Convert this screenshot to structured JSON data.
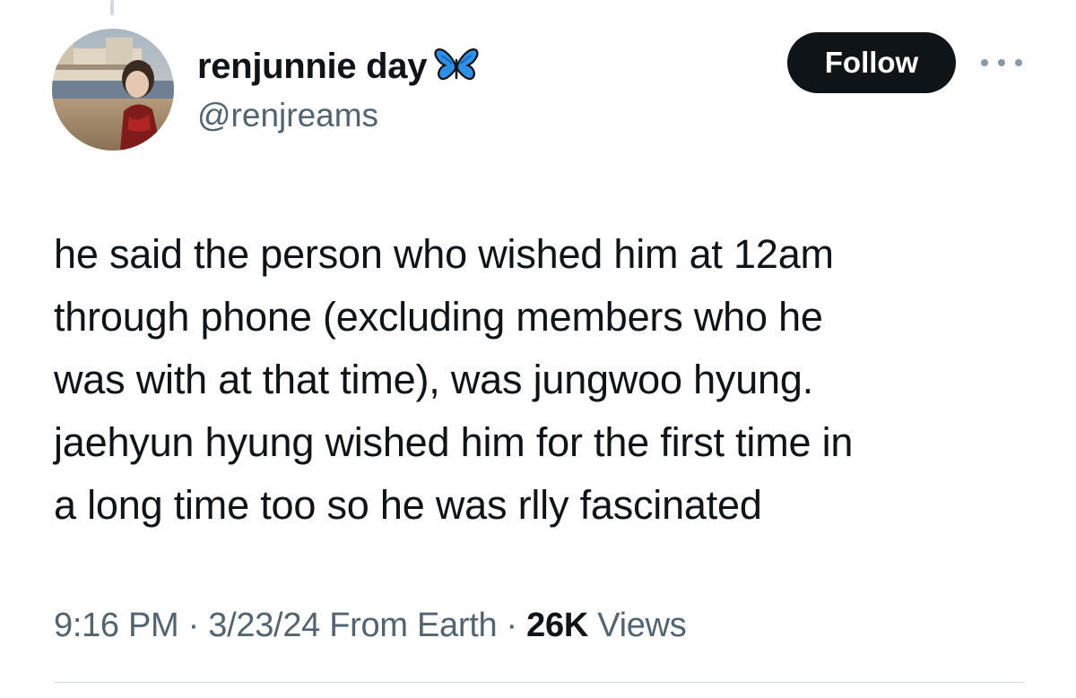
{
  "author": {
    "display_name": "renjunnie day",
    "badge_icon": "butterfly-icon",
    "handle": "@renjreams"
  },
  "actions": {
    "follow_label": "Follow",
    "more_icon": "more-horizontal-icon"
  },
  "tweet": {
    "lines": [
      "he said the person who wished him at 12am",
      "through phone (excluding members who he",
      "was with at that time), was jungwoo hyung.",
      "jaehyun hyung wished him for the first time in",
      "a long time too so he was rlly fascinated"
    ]
  },
  "meta": {
    "time": "9:16 PM",
    "separator": " · ",
    "date": "3/23/24",
    "source": "From Earth",
    "views_count": "26K",
    "views_label": "Views"
  },
  "colors": {
    "text_primary": "#0f1419",
    "text_secondary": "#536471",
    "follow_bg": "#0f1419",
    "divider": "#cfd9de",
    "butterfly": "#2d8fe6"
  }
}
